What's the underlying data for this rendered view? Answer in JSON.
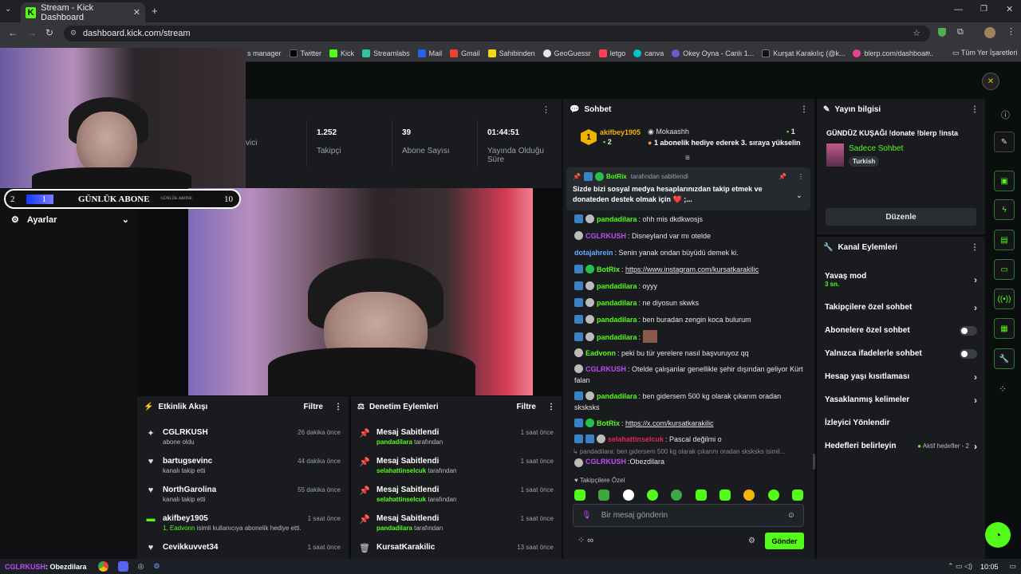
{
  "browser": {
    "tab_title": "Stream - Kick Dashboard",
    "url": "dashboard.kick.com/stream",
    "bookmarks": [
      "s manager",
      "Twitter",
      "Kick",
      "Streamlabs",
      "Mail",
      "Gmail",
      "Sahibinden",
      "GeoGuessr",
      "letgo",
      "canva",
      "Okey Oyna - Canlı 1...",
      "Kurşat Karakılıç (@k...",
      "blerp.com/dashboar..."
    ],
    "all_bookmarks": "Tüm Yer İşaretleri"
  },
  "overlay": {
    "abone_left": "2",
    "abone_mid": "1",
    "abone_label": "GÜNLÜK ABONE",
    "abone_small": "GÜNLÜK ABONE",
    "abone_right": "10"
  },
  "stats": [
    {
      "value": "",
      "label": "vici"
    },
    {
      "value": "1.252",
      "label": "Takipçi"
    },
    {
      "value": "39",
      "label": "Abone Sayısı"
    },
    {
      "value": "01:44:51",
      "label": "Yayında Olduğu Süre"
    }
  ],
  "left_sidebar": {
    "settings_label": "Ayarlar"
  },
  "activity": {
    "title": "Etkinlik Akışı",
    "filter": "Filtre",
    "rows": [
      {
        "name": "CGLRKUSH",
        "desc": "abone oldu",
        "time": "26 dakika önce",
        "icon": "sparkle-icon"
      },
      {
        "name": "bartugsevinc",
        "desc": "kanalı takip etti",
        "time": "44 dakika önce",
        "icon": "heart-icon"
      },
      {
        "name": "NorthGarolina",
        "desc": "kanalı takip etti",
        "time": "55 dakika önce",
        "icon": "heart-icon"
      },
      {
        "name": "akifbey1905",
        "desc_green": "1, Eadvonn",
        "desc": " isimli kullanıcıya abonelik hediye etti.",
        "time": "1 saat önce",
        "icon": "gift-icon"
      },
      {
        "name": "Cevikkuvvet34",
        "desc": "",
        "time": "1 saat önce",
        "icon": "heart-icon"
      }
    ]
  },
  "moderation": {
    "title": "Denetim Eylemleri",
    "filter": "Filtre",
    "rows": [
      {
        "name": "Mesaj Sabitlendi",
        "by": "pandadilara",
        "suffix": " tarafından",
        "time": "1 saat önce"
      },
      {
        "name": "Mesaj Sabitlendi",
        "by": "selahattinselcuk",
        "suffix": " tarafından",
        "time": "1 saat önce"
      },
      {
        "name": "Mesaj Sabitlendi",
        "by": "selahattinselcuk",
        "suffix": " tarafından",
        "time": "1 saat önce"
      },
      {
        "name": "Mesaj Sabitlendi",
        "by": "pandadilara",
        "suffix": " tarafından",
        "time": "1 saat önce"
      },
      {
        "name": "KursatKarakilic",
        "by": "",
        "suffix": "",
        "time": "13 saat önce"
      }
    ]
  },
  "chat": {
    "title": "Sohbet",
    "gifter": {
      "rank": "1",
      "name": "akifbey1905",
      "count": "2",
      "second_name": "Mokaashh",
      "second_count": "1",
      "subtitle": "1 abonelik hediye ederek 3. sıraya yükselin"
    },
    "pinned": {
      "by": "BotRix",
      "by_suffix": "tarafından sabitlendi",
      "text": "Sizde bizi sosyal medya hesaplarınızdan takip etmek ve donateden destek olmak için ❤️ ;..."
    },
    "messages": [
      {
        "user": "pandadilara",
        "color": "#53fc18",
        "badges": [
          "b-blue",
          "b-grey"
        ],
        "text": "ohh mis dkdkwosjs"
      },
      {
        "user": "CGLRKUSH",
        "color": "#c24cf6",
        "badges": [
          "b-grey"
        ],
        "text": "Disneyland var mı otelde"
      },
      {
        "user": "dotajahrein",
        "color": "#6aa7ff",
        "badges": [],
        "text": "Senin yanak ondan büyüdü demek ki."
      },
      {
        "user": "BotRix",
        "color": "#53fc18",
        "badges": [
          "b-blue",
          "b-green"
        ],
        "text": "https://www.instagram.com/kursatkarakilic",
        "link": true
      },
      {
        "user": "pandadilara",
        "color": "#53fc18",
        "badges": [
          "b-blue",
          "b-grey"
        ],
        "text": "oyyy"
      },
      {
        "user": "pandadilara",
        "color": "#53fc18",
        "badges": [
          "b-blue",
          "b-grey"
        ],
        "text": "ne diyosun skwks"
      },
      {
        "user": "pandadilara",
        "color": "#53fc18",
        "badges": [
          "b-blue",
          "b-grey"
        ],
        "text": "ben buradan zengin koca bulurum"
      },
      {
        "user": "pandadilara",
        "color": "#53fc18",
        "badges": [
          "b-blue",
          "b-grey"
        ],
        "text": "",
        "emote": true
      },
      {
        "user": "Eadvonn",
        "color": "#53fc18",
        "badges": [
          "b-grey"
        ],
        "text": "peki bu tür yerelere nasıl başvuruyoz qq"
      },
      {
        "user": "CGLRKUSH",
        "color": "#c24cf6",
        "badges": [
          "b-grey"
        ],
        "text": "Otelde çalışanlar genellikle şehir dışından geliyor Kürt falan"
      },
      {
        "user": "pandadilara",
        "color": "#53fc18",
        "badges": [
          "b-blue",
          "b-grey"
        ],
        "text": "ben gidersem 500 kg olarak çıkarım oradan sksksks"
      },
      {
        "user": "BotRix",
        "color": "#53fc18",
        "badges": [
          "b-blue",
          "b-green"
        ],
        "text": "https://x.com/kursatkarakilic",
        "link": true
      },
      {
        "user": "selahattinselcuk",
        "color": "#e0245e",
        "badges": [
          "b-blue",
          "b-blue",
          "b-grey"
        ],
        "text": "Pascal değilmi o"
      }
    ],
    "reply_to": "pandadilara: ben gidersem 500 kg olarak çıkarım oradan sksksks isimil...",
    "last": {
      "user": "CGLRKUSH",
      "text": "Obezdilara"
    },
    "followers_only": "Takipçilere Özel",
    "input_placeholder": "Bir mesaj gönderin",
    "send": "Gönder"
  },
  "stream_info": {
    "title": "Yayın bilgisi",
    "stream_title": "GÜNDÜZ KUŞAĞI !donate !blerp !insta",
    "category": "Sadece Sohbet",
    "tag": "Turkish",
    "edit": "Düzenle"
  },
  "channel_actions": {
    "title": "Kanal Eylemleri",
    "items": [
      {
        "label": "Yavaş mod",
        "sub": "3 sn.",
        "control": "chevron"
      },
      {
        "label": "Takipçilere özel sohbet",
        "control": "chevron"
      },
      {
        "label": "Abonelere özel sohbet",
        "control": "toggle"
      },
      {
        "label": "Yalnızca ifadelerle sohbet",
        "control": "toggle"
      },
      {
        "label": "Hesap yaşı kısıtlaması",
        "control": "chevron"
      },
      {
        "label": "Yasaklanmış kelimeler",
        "control": "chevron"
      },
      {
        "label": "İzleyici Yönlendir",
        "control": "none"
      },
      {
        "label": "Hedefleri belirleyin",
        "extra": "Aktif hedefler - 2",
        "control": "chevron"
      }
    ]
  },
  "taskbar": {
    "ticker_user": "CGLRKUSH",
    "ticker_text": ": Obezdilara",
    "clock": "10:05"
  }
}
